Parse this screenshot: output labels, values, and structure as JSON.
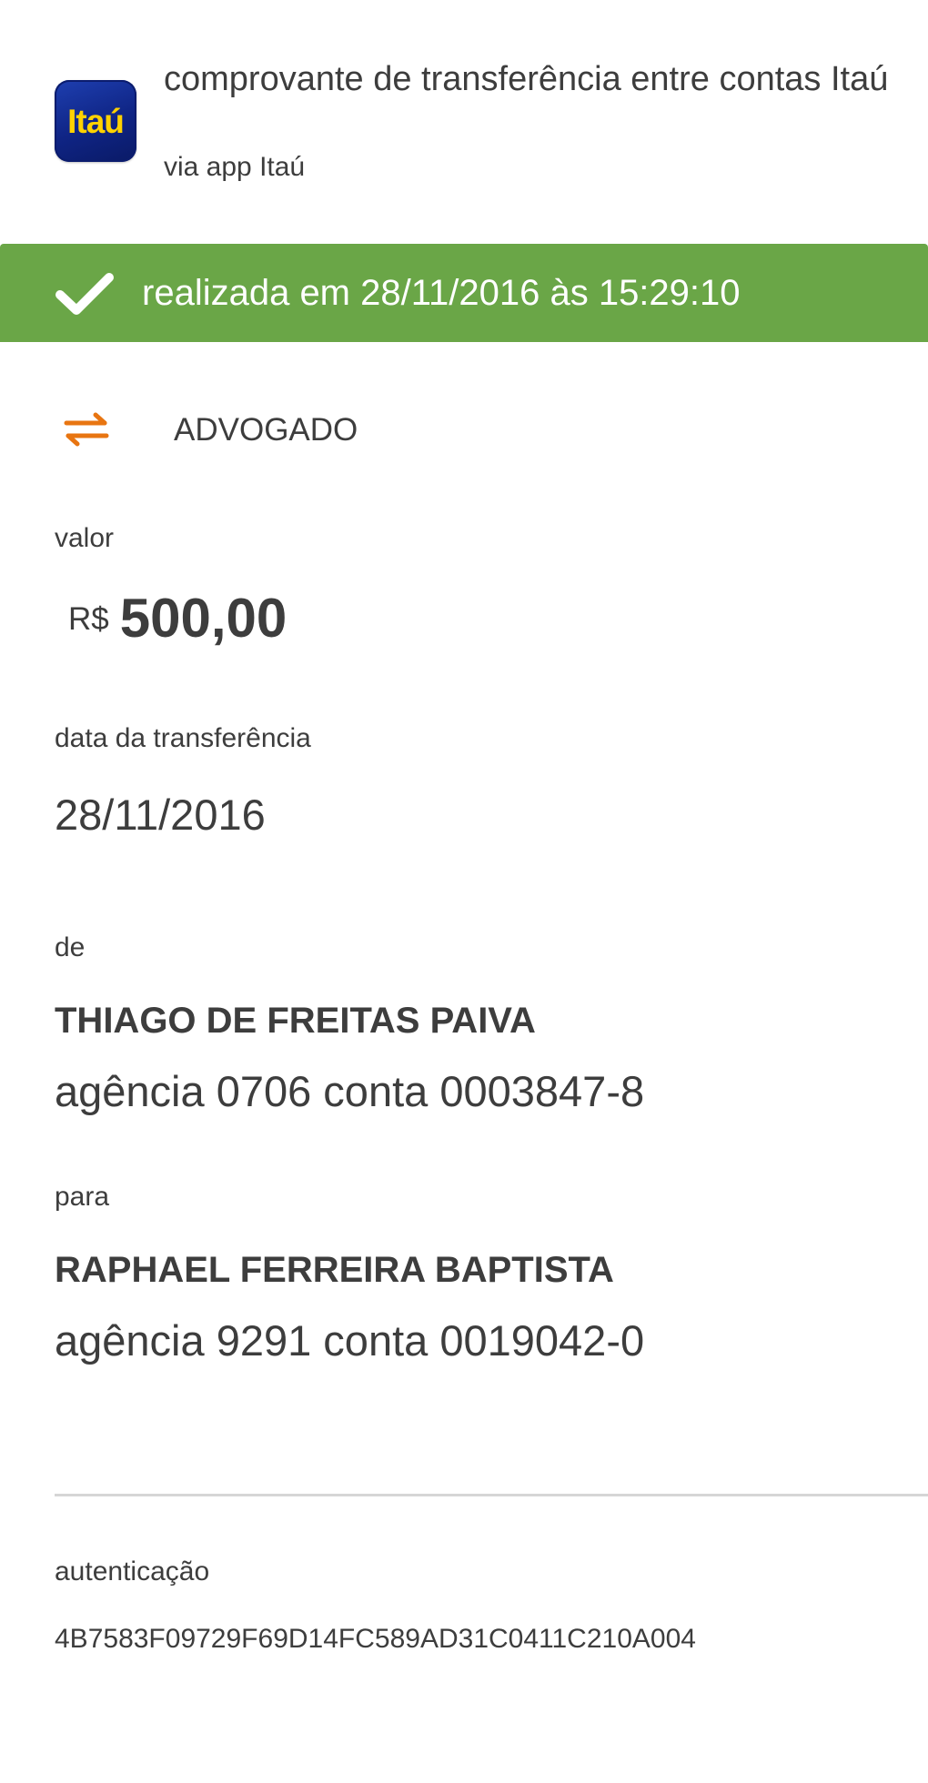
{
  "header": {
    "logo_text": "Itaú",
    "title": "comprovante de transferência entre contas Itaú",
    "subtitle": "via app Itaú"
  },
  "status": {
    "text": "realizada em 28/11/2016 às 15:29:10",
    "color": "#6aa647",
    "icon": "check-icon"
  },
  "transfer_type": {
    "icon": "transfer-arrows-icon",
    "icon_color": "#e87511",
    "label": "ADVOGADO"
  },
  "amount": {
    "label": "valor",
    "currency": "R$",
    "value": "500,00"
  },
  "transfer_date": {
    "label": "data da transferência",
    "value": "28/11/2016"
  },
  "from": {
    "label": "de",
    "name": "THIAGO DE FREITAS PAIVA",
    "account": "agência 0706 conta 0003847-8"
  },
  "to": {
    "label": "para",
    "name": "RAPHAEL FERREIRA BAPTISTA",
    "account": "agência 9291 conta 0019042-0"
  },
  "authentication": {
    "label": "autenticação",
    "code": "4B7583F09729F69D14FC589AD31C0411C210A004"
  }
}
